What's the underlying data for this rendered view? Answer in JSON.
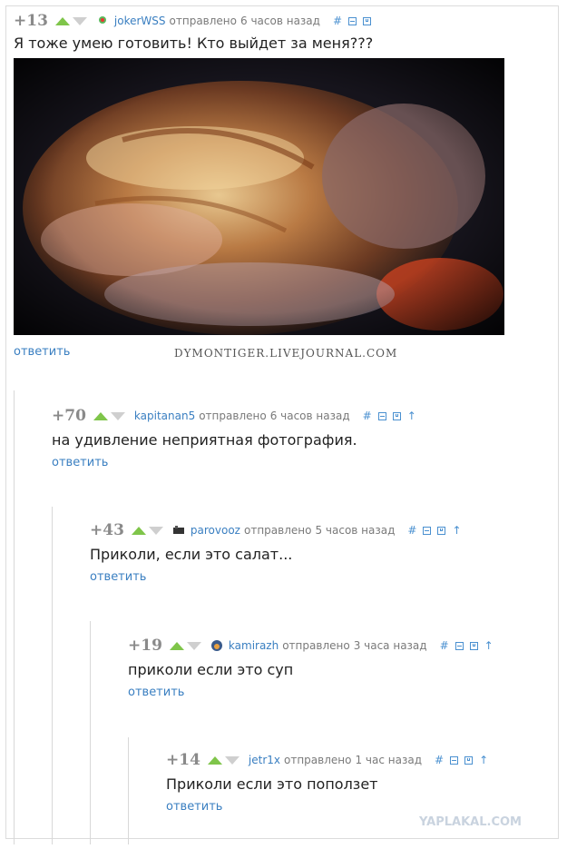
{
  "comments": [
    {
      "score": "+13",
      "user": "jokerWSS",
      "sent": "отправлено",
      "time": "6 часов назад",
      "text": "Я тоже умею готовить! Кто выйдет за меня???",
      "reply": "ответить"
    },
    {
      "score": "+70",
      "user": "kapitanan5",
      "sent": "отправлено",
      "time": "6 часов назад",
      "text": "на удивление неприятная фотография.",
      "reply": "ответить"
    },
    {
      "score": "+43",
      "user": "parovooz",
      "sent": "отправлено",
      "time": "5 часов назад",
      "text": "Приколи, если это салат...",
      "reply": "ответить"
    },
    {
      "score": "+19",
      "user": "kamirazh",
      "sent": "отправлено",
      "time": "3 часа назад",
      "text": "приколи если это суп",
      "reply": "ответить"
    },
    {
      "score": "+14",
      "user": "jetr1x",
      "sent": "отправлено",
      "time": "1 час назад",
      "text": "Приколи если это поползет",
      "reply": "ответить"
    }
  ],
  "photo_watermark": "DYMONTIGER.LIVEJOURNAL.COM",
  "site_watermark": "YAPLAKAL.COM",
  "icons": {
    "hash": "#",
    "up_arrow": "↑"
  },
  "colors": {
    "vote_up": "#7fc54a",
    "vote_down": "#cfcfcf",
    "link": "#3a7fc1",
    "score": "#8a8a8a"
  }
}
